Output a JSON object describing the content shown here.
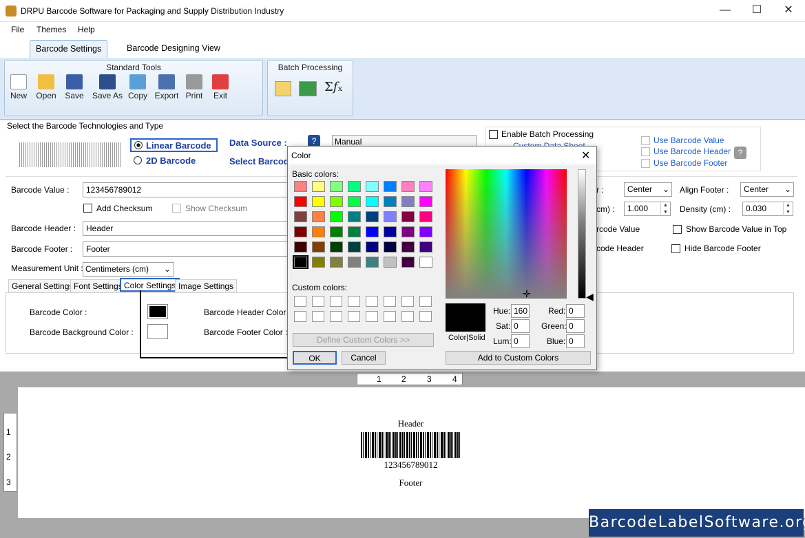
{
  "window": {
    "title": "DRPU Barcode Software for Packaging and Supply Distribution Industry",
    "min": "—",
    "max": "☐",
    "close": "✕"
  },
  "menu": [
    "File",
    "Themes",
    "Help"
  ],
  "tabs": [
    "Barcode Settings",
    "Barcode Designing View"
  ],
  "ribbon": {
    "standard_title": "Standard Tools",
    "tools": [
      "New",
      "Open",
      "Save",
      "Save As",
      "Copy",
      "Export",
      "Print",
      "Exit"
    ],
    "batch_title": "Batch Processing",
    "sigma": "Σ𝑓ₓ"
  },
  "tech": {
    "section_title": "Select the Barcode Technologies and Type",
    "linear": "Linear Barcode",
    "twod": "2D Barcode",
    "data_source_label": "Data Source :",
    "data_source_value": "Manual",
    "select_barcode_label": "Select Barcod"
  },
  "batch": {
    "enable": "Enable Batch Processing",
    "custom_sheet": "Custom Data Sheet",
    "use_value": "Use Barcode Value",
    "use_header": "Use Barcode Header",
    "use_footer": "Use Barcode Footer"
  },
  "form": {
    "value_label": "Barcode Value :",
    "value": "123456789012",
    "add_checksum": "Add Checksum",
    "show_checksum": "Show Checksum",
    "header_label": "Barcode Header :",
    "header": "Header",
    "footer_label": "Barcode Footer :",
    "footer": "Footer",
    "unit_label": "Measurement Unit :",
    "unit": "Centimeters (cm)"
  },
  "right": {
    "align_header_tail": "r :",
    "align_header": "Center",
    "align_footer_label": "Align Footer :",
    "align_footer": "Center",
    "height_tail": "cm) :",
    "height": "1.000",
    "density_label": "Density (cm) :",
    "density": "0.030",
    "hide_value_tail": "rcode Value",
    "show_top": "Show Barcode Value in Top",
    "hide_header_tail": "code Header",
    "hide_footer": "Hide Barcode Footer"
  },
  "subtabs": [
    "General Settings",
    "Font Settings",
    "Color Settings",
    "Image Settings"
  ],
  "colors": {
    "barcode_color": "Barcode Color :",
    "bg_color": "Barcode Background Color :",
    "header_color": "Barcode Header Color :",
    "footer_color": "Barcode Footer Color :"
  },
  "preview": {
    "header": "Header",
    "value": "123456789012",
    "footer": "Footer",
    "ruler_top": [
      "1",
      "2",
      "3",
      "4"
    ],
    "ruler_left": [
      "1",
      "2",
      "3"
    ]
  },
  "dialog": {
    "title": "Color",
    "basic": "Basic colors:",
    "custom": "Custom colors:",
    "define": "Define Custom Colors >>",
    "ok": "OK",
    "cancel": "Cancel",
    "colorsolid": "Color|Solid",
    "hue_label": "Hue:",
    "hue": "160",
    "sat_label": "Sat:",
    "sat": "0",
    "lum_label": "Lum:",
    "lum": "0",
    "red_label": "Red:",
    "red": "0",
    "green_label": "Green:",
    "green": "0",
    "blue_label": "Blue:",
    "blue": "0",
    "add": "Add to Custom Colors",
    "swatches": [
      "#ff8080",
      "#ffff80",
      "#80ff80",
      "#00ff80",
      "#80ffff",
      "#0080ff",
      "#ff80c0",
      "#ff80ff",
      "#ff0000",
      "#ffff00",
      "#80ff00",
      "#00ff40",
      "#00ffff",
      "#0080c0",
      "#8080c0",
      "#ff00ff",
      "#804040",
      "#ff8040",
      "#00ff00",
      "#008080",
      "#004080",
      "#8080ff",
      "#800040",
      "#ff0080",
      "#800000",
      "#ff8000",
      "#008000",
      "#008040",
      "#0000ff",
      "#0000a0",
      "#800080",
      "#8000ff",
      "#400000",
      "#804000",
      "#004000",
      "#004040",
      "#000080",
      "#000040",
      "#400040",
      "#400080",
      "#000000",
      "#808000",
      "#808040",
      "#808080",
      "#408080",
      "#c0c0c0",
      "#400040",
      "#ffffff"
    ]
  },
  "brand": "BarcodeLabelSoftware.org"
}
